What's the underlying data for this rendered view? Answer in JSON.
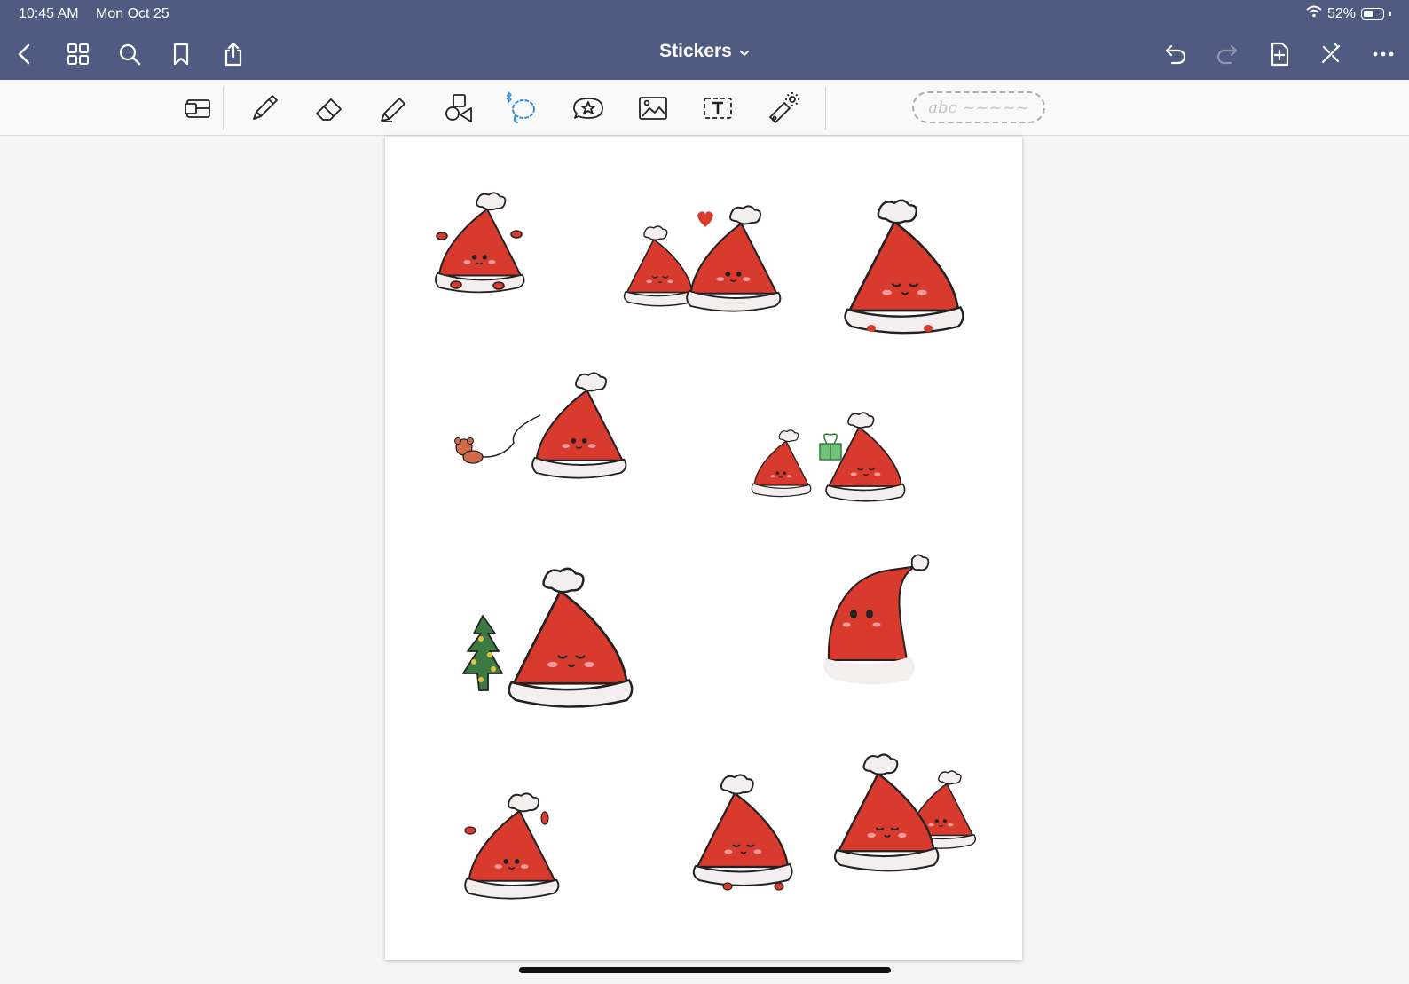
{
  "status_bar": {
    "time": "10:45 AM",
    "date": "Mon Oct 25",
    "battery_percent": "52%",
    "battery_level": 0.52,
    "wifi_icon": "wifi-icon"
  },
  "nav": {
    "title": "Stickers",
    "left_icons": [
      "back-icon",
      "thumbnails-icon",
      "search-icon",
      "bookmark-icon",
      "share-icon"
    ],
    "right_icons": [
      "undo-icon",
      "redo-icon",
      "add-page-icon",
      "close-tools-icon",
      "more-icon"
    ]
  },
  "toolbar": {
    "tools": [
      "zoom-window-tool",
      "pen-tool",
      "eraser-tool",
      "highlighter-tool",
      "shapes-tool",
      "lasso-tool",
      "stickers-tool",
      "image-tool",
      "text-tool",
      "laser-pointer-tool"
    ],
    "active_tool": "lasso-tool",
    "bluetooth_icon": "bluetooth-icon",
    "handwriting_placeholder": "abc ~~~~~"
  },
  "colors": {
    "nav_bar": "#4f5b80",
    "hat_red": "#d83b2e",
    "fur_white": "#f4eeee",
    "accent_blue": "#2e8fe0",
    "tree_green": "#3c7a43",
    "gift_green": "#6fc277"
  },
  "stickers": [
    {
      "name": "hat-waving",
      "pose": "single"
    },
    {
      "name": "hats-kissing",
      "pose": "pair"
    },
    {
      "name": "hat-large-smiling",
      "pose": "single"
    },
    {
      "name": "hat-walking-teddy",
      "pose": "with-pet"
    },
    {
      "name": "hats-gift",
      "pose": "pair"
    },
    {
      "name": "hat-with-tree",
      "pose": "with-tree"
    },
    {
      "name": "hat-floppy",
      "pose": "single"
    },
    {
      "name": "hat-cheering",
      "pose": "single"
    },
    {
      "name": "hat-blushing",
      "pose": "single"
    },
    {
      "name": "hats-hugging",
      "pose": "pair"
    }
  ]
}
